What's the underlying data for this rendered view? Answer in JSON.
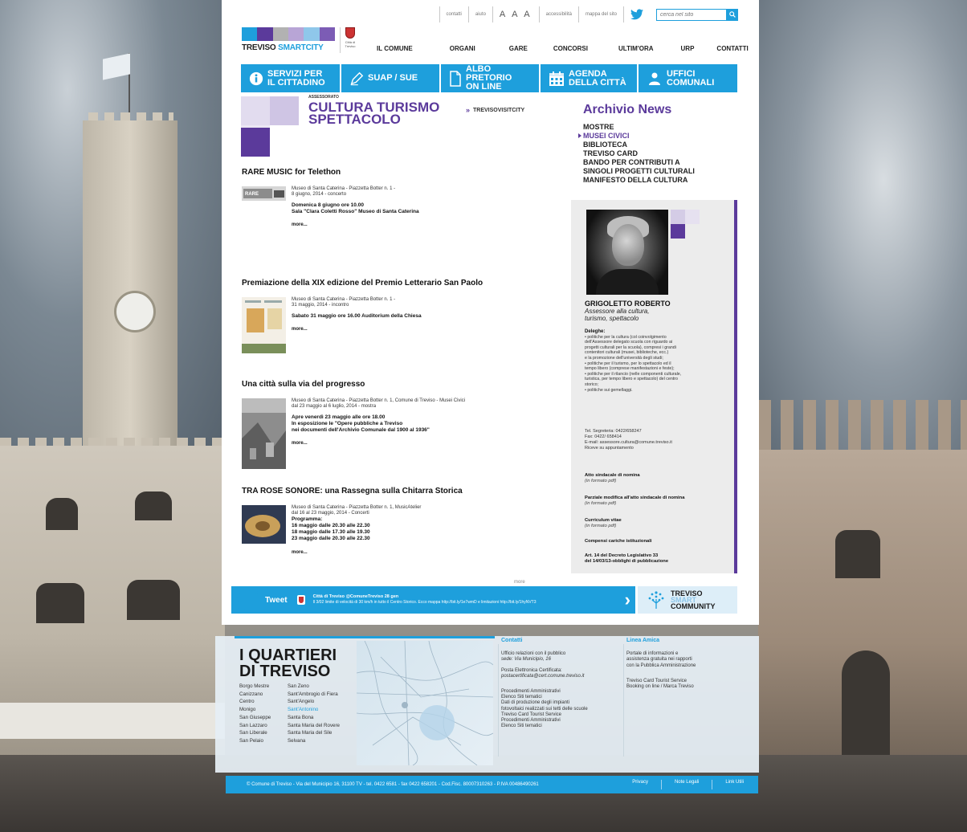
{
  "colors": {
    "accent_blue": "#1e9fdc",
    "purple": "#5b3a9b",
    "page_bg": "#ffffff"
  },
  "topbar": {
    "links": [
      "contatti",
      "aiuto",
      "accessibilità",
      "mappa del sito"
    ],
    "font_sizes": "A A A",
    "search_placeholder": "cerca nel sito",
    "twitter_icon": "twitter-bird-icon"
  },
  "logo": {
    "brand_left": "TREVISO",
    "brand_right": "SMARTCITY",
    "crest_label": "Città di Treviso"
  },
  "main_nav": [
    "IL COMUNE",
    "ORGANI",
    "GARE",
    "CONCORSI",
    "ULTIM'ORA",
    "URP",
    "CONTATTI"
  ],
  "services": [
    {
      "label_1": "SERVIZI PER",
      "label_2": "IL CITTADINO",
      "icon": "info-icon"
    },
    {
      "label_1": "SUAP / SUE",
      "label_2": "",
      "icon": "pen-icon"
    },
    {
      "label_1": "ALBO PRETORIO",
      "label_2": "ON LINE",
      "icon": "document-icon"
    },
    {
      "label_1": "AGENDA",
      "label_2": "DELLA CITTÀ",
      "icon": "calendar-icon"
    },
    {
      "label_1": "UFFICI",
      "label_2": "COMUNALI",
      "icon": "people-icon"
    }
  ],
  "section": {
    "small": "ASSESSORATO",
    "title_1": "CULTURA TURISMO",
    "title_2": "SPETTACOLO",
    "link": "TREVISOVISITCITY"
  },
  "news": [
    {
      "title": "RARE MUSIC for Telethon",
      "meta_1": "Museo di Santa Caterina - Piazzetta Botter n. 1 -",
      "meta_2": "8 giugno, 2014 - concerto",
      "detail_1": "Domenica 8 giugno ore 10.00",
      "detail_2": "Sala \"Clara Coletti Rosso\"  Museo di Santa Caterina",
      "detail_3": "",
      "more": "more..."
    },
    {
      "title": "Premiazione della XIX edizione del Premio Letterario San Paolo",
      "meta_1": "Museo di Santa Caterina - Piazzetta Botter n. 1 -",
      "meta_2": "31 maggio, 2014 - incontro",
      "detail_1": "Sabato 31 maggio ore 16.00 Auditorium della Chiesa",
      "detail_2": "",
      "detail_3": "",
      "more": "more..."
    },
    {
      "title": "Una città sulla via del progresso",
      "meta_1": "Museo di Santa Caterina - Piazzetta Botter n. 1, Comune di Treviso - Musei Civici",
      "meta_2": "dal 23 maggio al 6 luglio, 2014 - mostra",
      "detail_1": "Apre venerdì 23 maggio alle ore 18.00",
      "detail_2": "In esposizione le \"Opere pubbliche a Treviso",
      "detail_3": "nei documenti dell'Archivio Comunale dal 1900 al 1936\"",
      "more": "more..."
    },
    {
      "title": "TRA ROSE SONORE: una Rassegna sulla Chitarra Storica",
      "meta_1": "Museo di Santa Caterina - Piazzetta Botter n. 1, MusicAtelier",
      "meta_2": "dal 16 al 23 maggio, 2014 - Concerti",
      "detail_1": "Programma:",
      "detail_2": "16 maggio dalle 20.30 alle 22.30",
      "detail_3": "18 maggio dalle 17.30 alle 19.30",
      "detail_4": "23 maggio dalle 20.30 alle 22.30",
      "more": "more..."
    }
  ],
  "more_all": "more",
  "archive": {
    "title": "Archivio News",
    "items": [
      "MOSTRE",
      "MUSEI CIVICI",
      "BIBLIOTECA",
      "TREVISO CARD",
      "BANDO PER CONTRIBUTI A",
      "SINGOLI PROGETTI CULTURALI",
      "MANIFESTO DELLA CULTURA"
    ]
  },
  "assessor": {
    "name": "GRIGOLETTO ROBERTO",
    "role_1": "Assessore alla cultura,",
    "role_2": "turismo, spettacolo",
    "deleghe_title": "Deleghe:",
    "deleghe": [
      "• politiche per la cultura (col coinvolgimento",
      "dell'Assessore delegato scuola con riguardo ai",
      "progetti culturali per la scuola), compresi i grandi",
      "contenitori culturali (musei, biblioteche, ecc.)",
      "e la  promozione dell'università degli studi;",
      "• politiche per il turismo, per lo spettacolo ed il",
      "tempo libero (comprese manifestazioni e feste);",
      "• politiche per il rilancio (nelle componenti culturale,",
      "turistica, per tempo libero e spettacolo) del centro",
      "storico;",
      "• politiche sui gemellaggi."
    ],
    "contacts": [
      "Tel. Segreteria: 0422/658247",
      "Fax: 0422/ 658414",
      "E-mail: assessore.cultura@comune.treviso.it",
      "Riceve su appuntamento"
    ],
    "docs": [
      {
        "label": "Atto sindacale di nomina",
        "sub": "(in formato pdf)"
      },
      {
        "label": "Parziale modifica all'atto sindacale di nomina",
        "sub": "(in formato pdf)"
      },
      {
        "label": "Curriculum vitae",
        "sub": "(in formato pdf)"
      },
      {
        "label": "Compensi cariche istituzionali",
        "sub": ""
      },
      {
        "label": "Art. 14 del Decreto Legislativo 33",
        "sub": "del 14/03/13-obblighi di pubblicazione"
      }
    ]
  },
  "tweet": {
    "label": "Tweet",
    "head": "Città di Treviso @ComuneTreviso  28 gen",
    "text": "Il 3/02 limite di velocità di 30 km/h in tutto il Centro Storico. Ecco mappa http://bit.ly/1e7wmD e limitazioni http://bit.ly/1hyNVT3"
  },
  "smart_community": {
    "l1": "TREVISO",
    "l2": "SMART",
    "l3": "COMMUNITY"
  },
  "quartieri": {
    "title_1": "I QUARTIERI",
    "title_2": "DI TREVISO",
    "col1": [
      "Borgo Mestre",
      "Canizzano",
      "Centro",
      "Monigo",
      "San Giuseppe",
      "San Lazzaro",
      "San Liberale",
      "San Pelaio"
    ],
    "col2": [
      "San Zeno",
      "Sant'Ambrogio di Fiera",
      "Sant'Angelo",
      "Sant'Antonino",
      "Santa Bona",
      "Santa Maria del Rovere",
      "Santa Maria del Sile",
      "Selvana"
    ],
    "highlight": "Sant'Antonino"
  },
  "contatti": {
    "title": "Contatti",
    "lines_1": [
      "Ufficio relazioni con il pubblico",
      "sede: Via Municipio, 16"
    ],
    "lines_2": [
      "Posta Elettronica Certificata:",
      "postacertificata@cert.comune.treviso.it"
    ],
    "links": [
      "Procedimenti Amministrativi",
      "Elenco Siti tematici",
      "Dati di produzione degli impianti",
      "fotovoltaici realizzati sui tetti delle scuole",
      "Treviso Card Tourist Service",
      "Procedimenti Amministrativi",
      "Elenco Siti tematici"
    ]
  },
  "linea_amica": {
    "title": "Linea Amica",
    "lines": [
      "Portale di informazioni e",
      "assistenza gratuita nei rapporti",
      "con la Pubblica Amministrazione"
    ],
    "links": [
      "Treviso Card Tourist Service",
      "Booking on line / Marca Treviso"
    ]
  },
  "footer_bar": {
    "copyright": "© Comune di Treviso - Via del Municipio 16, 31100 TV - tel. 0422 6581 - fax 0422 658201 - Cod.Fisc. 80007310263 - P.IVA 00486490261",
    "links": [
      "Privacy",
      "Note Legali",
      "Link Utili"
    ]
  }
}
